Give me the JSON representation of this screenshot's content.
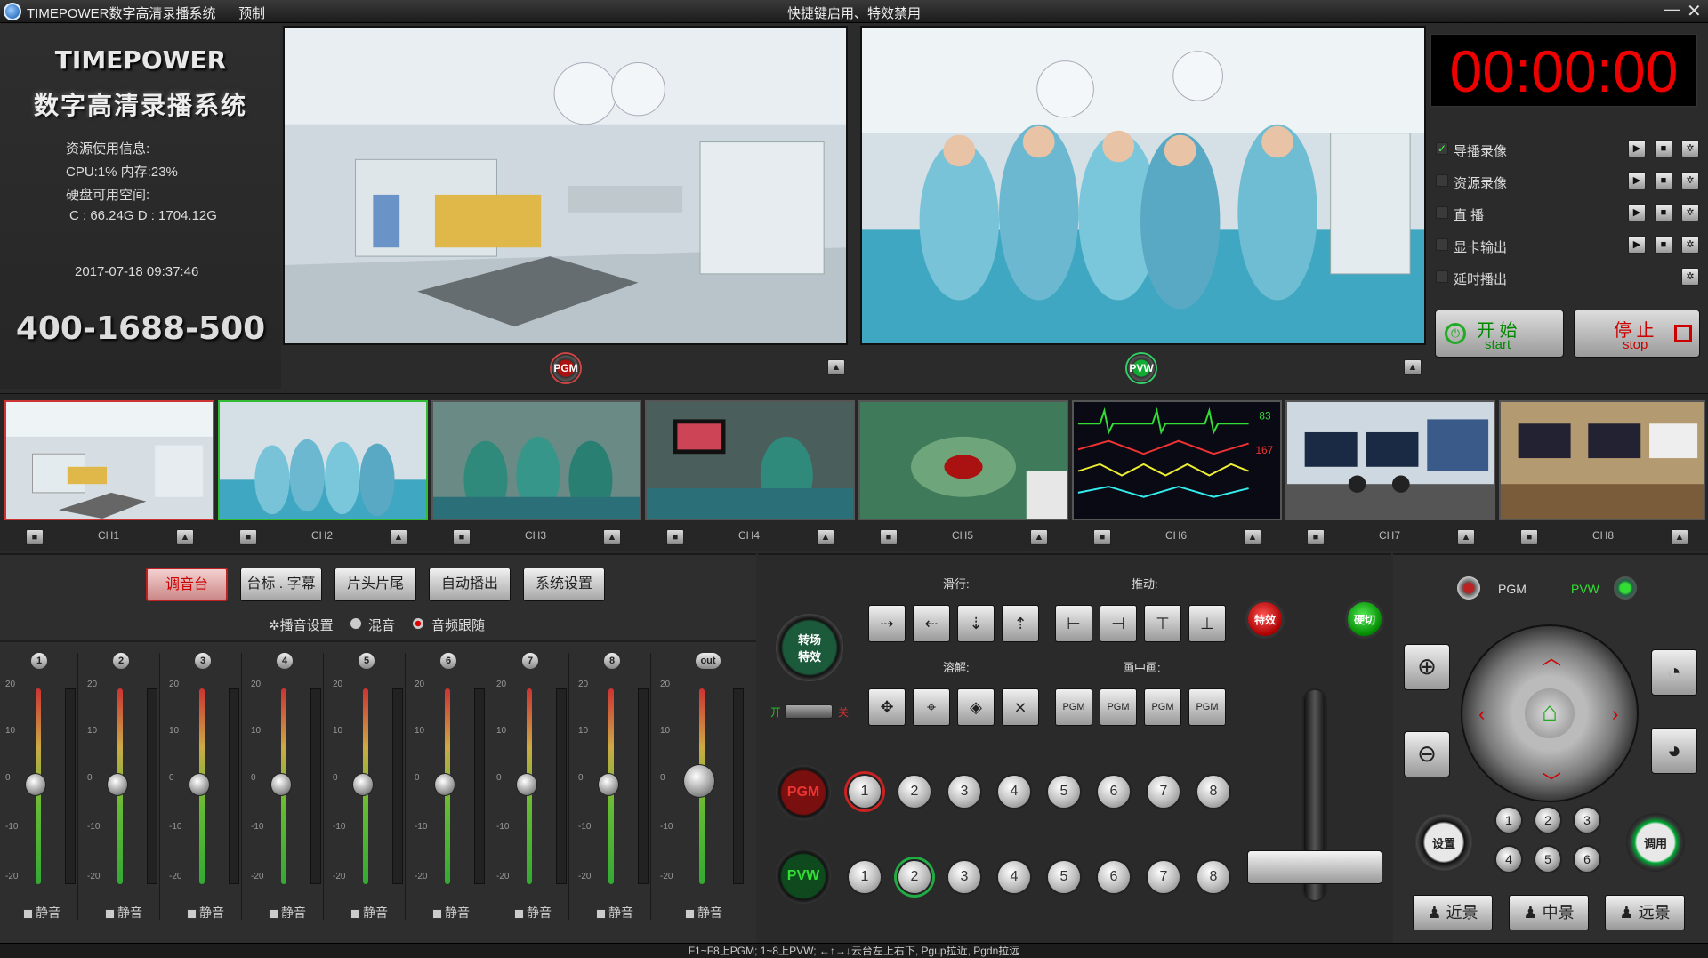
{
  "titlebar": {
    "app_name": "TIMEPOWER数字高清录播系统",
    "menu_preset": "预制",
    "center_notice": "快捷键启用、特效禁用",
    "minimize": "—",
    "close": "✕"
  },
  "info": {
    "brand_en": "TIMEPOWER",
    "brand_cn": "数字高清录播系统",
    "resource_title": "资源使用信息:",
    "cpu_mem": "CPU:1% 内存:23%",
    "disk_title": "硬盘可用空间:",
    "disk_values": "C : 66.24G D : 1704.12G",
    "datetime": "2017-07-18 09:37:46",
    "phone": "400-1688-500"
  },
  "monitors": {
    "pgm_label": "PGM",
    "pvw_label": "PVW"
  },
  "timer": "00:00:00",
  "recording": [
    {
      "label": "导播录像",
      "checked": true,
      "has_play": true
    },
    {
      "label": "资源录像",
      "checked": false,
      "has_play": true
    },
    {
      "label": "直 播",
      "checked": false,
      "has_play": true
    },
    {
      "label": "显卡输出",
      "checked": false,
      "has_play": true
    },
    {
      "label": "延时播出",
      "checked": false,
      "has_play": false
    }
  ],
  "start_btn": {
    "cn": "开  始",
    "en": "start"
  },
  "stop_btn": {
    "cn": "停  止",
    "en": "stop"
  },
  "channels": [
    "CH1",
    "CH2",
    "CH3",
    "CH4",
    "CH5",
    "CH6",
    "CH7",
    "CH8"
  ],
  "tabs": [
    "调音台",
    "台标 . 字幕",
    "片头片尾",
    "自动播出",
    "系统设置"
  ],
  "audio_options": {
    "settings": "播音设置",
    "mix": "混音",
    "follow": "音频跟随"
  },
  "mixer": {
    "channels": [
      "1",
      "2",
      "3",
      "4",
      "5",
      "6",
      "7",
      "8",
      "out"
    ],
    "scale": [
      "20",
      "10",
      "0",
      "-10",
      "-20"
    ],
    "mute": "静音"
  },
  "effects": {
    "slide_label": "滑行:",
    "push_label": "推动:",
    "dissolve_label": "溶解:",
    "pip_label": "画中画:",
    "transition": "转场\n特效",
    "on": "开",
    "off": "关",
    "fx_btn": "特效",
    "quick_cut": "硬切",
    "pip_btn": "PGM",
    "pgm": "PGM",
    "pvw": "PVW",
    "numbers": [
      "1",
      "2",
      "3",
      "4",
      "5",
      "6",
      "7",
      "8"
    ],
    "pgm_active": "1",
    "pvw_active": "2"
  },
  "ptz": {
    "pgm": "PGM",
    "pvw": "PVW",
    "settings": "设置",
    "call": "调用",
    "presets": [
      "1",
      "2",
      "3",
      "4",
      "5",
      "6"
    ],
    "near": "近景",
    "mid": "中景",
    "far": "远景"
  },
  "statusbar": "F1~F8上PGM; 1~8上PVW; ←↑→↓云台左上右下, Pgup拉近, Pgdn拉远",
  "colors": {
    "accent_red": "#e00000",
    "pgm_red": "#cc2222",
    "pvw_green": "#22aa44"
  }
}
